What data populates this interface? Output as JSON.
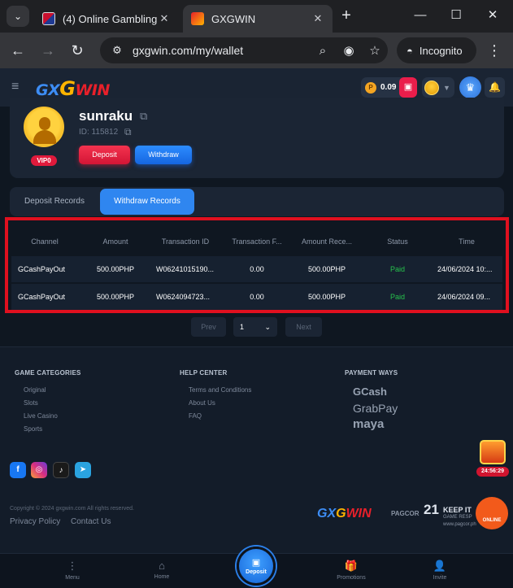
{
  "browser": {
    "tabs": [
      {
        "title": "(4) Online Gambling |",
        "active": false
      },
      {
        "title": "GXGWIN",
        "active": true
      }
    ],
    "url": "gxgwin.com/my/wallet",
    "incognito_label": "Incognito",
    "icons": {
      "tab_menu": "chevron-down-icon",
      "new_tab": "plus-icon",
      "back": "arrow-left-icon",
      "forward": "arrow-right-icon",
      "reload": "reload-icon",
      "zoom": "magnifier-icon",
      "eye_off": "eye-off-icon",
      "star": "star-icon",
      "more": "kebab-icon"
    }
  },
  "site": {
    "logo": {
      "part1": "GX",
      "part2": "G",
      "part3": "WIN"
    },
    "balance": "0.09",
    "coin_symbol": "P",
    "colors": {
      "accent_blue": "#2f86f0",
      "accent_red": "#e01a3c",
      "paid_green": "#27c24c",
      "gold": "#ffb400"
    }
  },
  "profile": {
    "username": "sunraku",
    "id_text": "ID: 115812",
    "vip_label": "VIP0",
    "deposit_label": "Deposit",
    "withdraw_label": "Withdraw"
  },
  "record_tabs": {
    "deposit": "Deposit Records",
    "withdraw": "Withdraw Records",
    "active": "withdraw"
  },
  "table": {
    "headers": [
      "Channel",
      "Amount",
      "Transaction ID",
      "Transaction F...",
      "Amount Rece...",
      "Status",
      "Time"
    ],
    "rows": [
      [
        "GCashPayOut",
        "500.00PHP",
        "W06241015190...",
        "0.00",
        "500.00PHP",
        "Paid",
        "24/06/2024 10:..."
      ],
      [
        "GCashPayOut",
        "500.00PHP",
        "W0624094723...",
        "0.00",
        "500.00PHP",
        "Paid",
        "24/06/2024 09..."
      ]
    ]
  },
  "pagination": {
    "prev": "Prev",
    "page": "1",
    "next": "Next"
  },
  "footer": {
    "game_categories": {
      "title": "GAME CATEGORIES",
      "items": [
        "Original",
        "Slots",
        "Live Casino",
        "Sports"
      ]
    },
    "help_center": {
      "title": "HELP CENTER",
      "items": [
        "Terms and Conditions",
        "About Us",
        "FAQ"
      ]
    },
    "payment_ways": {
      "title": "PAYMENT WAYS",
      "items": [
        "GCash",
        "GrabPay",
        "maya"
      ]
    },
    "social_icons": [
      "facebook-icon",
      "instagram-icon",
      "tiktok-icon",
      "telegram-icon"
    ],
    "copyright": "Copyright © 2024 gxgwin.com All rights reserved.",
    "privacy_policy": "Privacy Policy",
    "contact_us": "Contact Us",
    "pagcor": "PAGCOR",
    "age": "21",
    "keep_it": "KEEP IT",
    "keep_it_sub": "GAME RESP",
    "keep_it_site": "www.pagcor.ph"
  },
  "floating": {
    "timer": "24:56:29",
    "support_label": "ONLINE"
  },
  "bottom_nav": {
    "menu": "Menu",
    "home": "Home",
    "deposit": "Deposit",
    "promotions": "Promotions",
    "invite": "Invite"
  }
}
